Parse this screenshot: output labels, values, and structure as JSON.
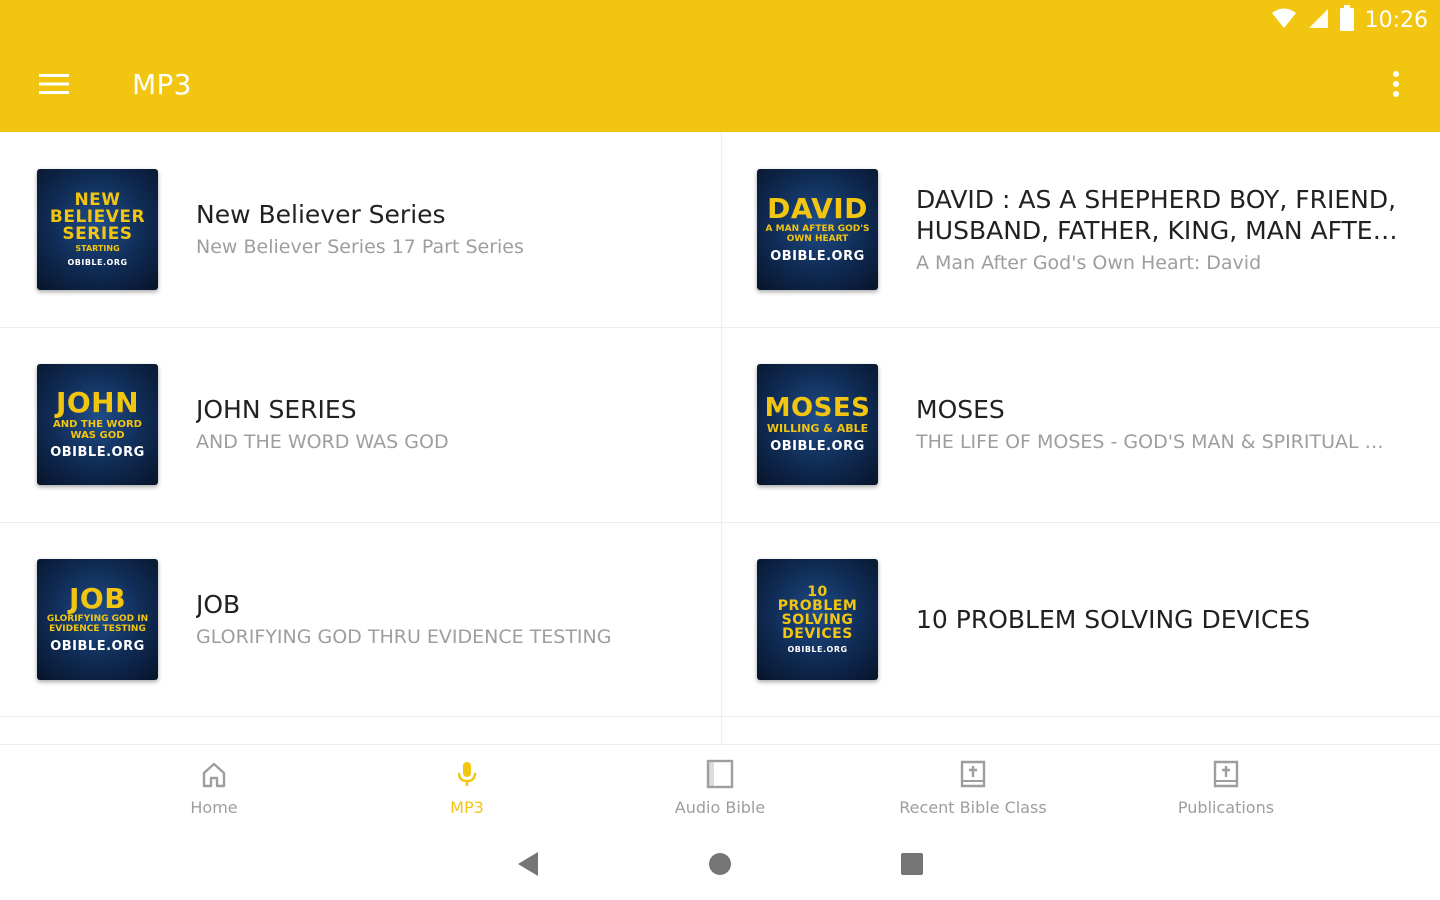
{
  "status": {
    "time": "10:26"
  },
  "appbar": {
    "title": "MP3"
  },
  "items": [
    {
      "title": "New Believer Series",
      "subtitle": "New Believer Series 17 Part Series",
      "thumb": {
        "title": "NEW BELIEVER SERIES",
        "sub": "STARTING",
        "site": "OBIBLE.ORG"
      }
    },
    {
      "title": "DAVID : AS A SHEPHERD BOY, FRIEND, HUSBAND, FATHER, KING, MAN AFTER GOD'S OWN HEART",
      "subtitle": "A Man After God's Own Heart: David",
      "thumb": {
        "title": "DAVID",
        "sub": "A MAN AFTER GOD'S OWN HEART",
        "site": "OBIBLE.ORG"
      }
    },
    {
      "title": "JOHN SERIES",
      "subtitle": "AND THE WORD WAS GOD",
      "thumb": {
        "title": "JOHN",
        "sub": "AND THE WORD WAS GOD",
        "site": "OBIBLE.ORG"
      }
    },
    {
      "title": "MOSES",
      "subtitle": "THE LIFE OF MOSES - GOD'S MAN & SPIRITUAL WARRIOR",
      "thumb": {
        "title": "MOSES",
        "sub": "WILLING & ABLE",
        "site": "OBIBLE.ORG"
      }
    },
    {
      "title": "JOB",
      "subtitle": "GLORIFYING GOD THRU EVIDENCE TESTING",
      "thumb": {
        "title": "JOB",
        "sub": "GLORIFYING GOD IN EVIDENCE TESTING",
        "site": "OBIBLE.ORG"
      }
    },
    {
      "title": "10 PROBLEM SOLVING DEVICES",
      "subtitle": "",
      "thumb": {
        "title": "10 PROBLEM SOLVING DEVICES",
        "sub": "",
        "site": "OBIBLE.ORG"
      }
    }
  ],
  "bottom_nav": [
    {
      "label": "Home",
      "icon": "home-icon",
      "active": false
    },
    {
      "label": "MP3",
      "icon": "microphone-icon",
      "active": true
    },
    {
      "label": "Audio Bible",
      "icon": "book-icon",
      "active": false
    },
    {
      "label": "Recent Bible Class",
      "icon": "bible-icon",
      "active": false
    },
    {
      "label": "Publications",
      "icon": "bible-icon",
      "active": false
    }
  ],
  "colors": {
    "accent": "#F2C511",
    "text_primary": "#212121",
    "text_secondary": "#9e9e9e",
    "thumb_bg": "#0f2a52"
  }
}
